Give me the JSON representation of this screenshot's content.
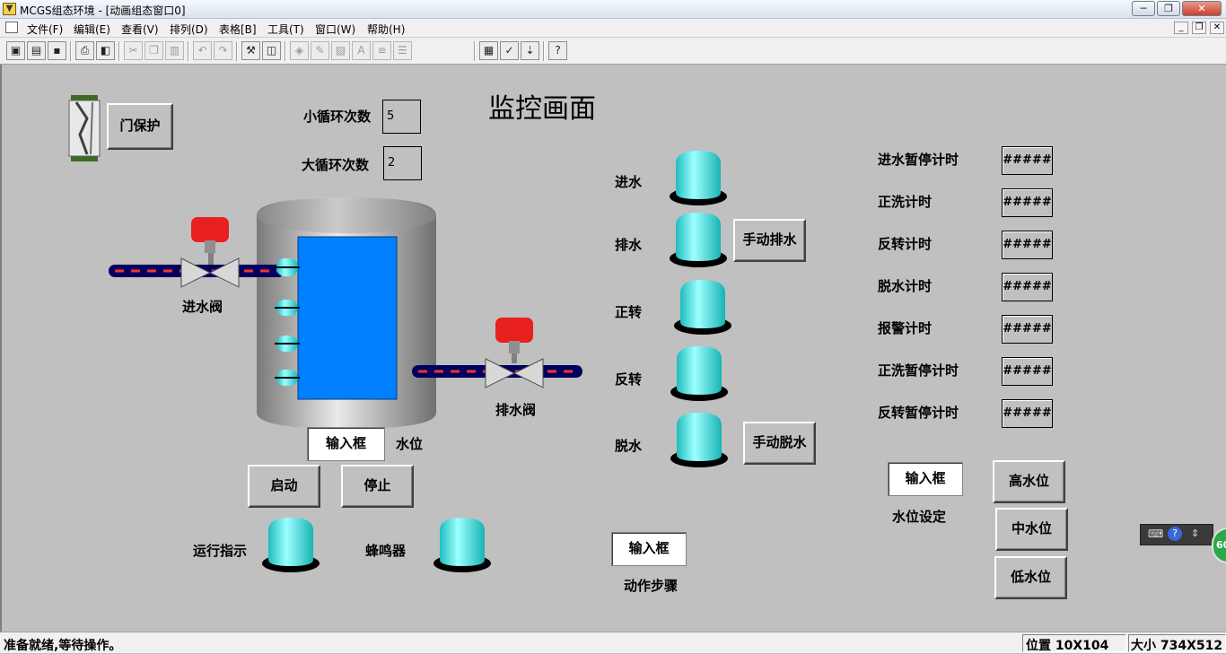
{
  "window": {
    "title": "MCGS组态环境 - [动画组态窗口0]",
    "icon": "mcgs-app-icon",
    "controls": {
      "minimize": "─",
      "restore": "❐",
      "close": "✕"
    }
  },
  "menubar": {
    "items": [
      "文件(F)",
      "编辑(E)",
      "查看(V)",
      "排列(D)",
      "表格[B]",
      "工具(T)",
      "窗口(W)",
      "帮助(H)"
    ],
    "mdi_controls": {
      "minimize": "_",
      "restore": "❐",
      "close": "✕"
    }
  },
  "toolbar": {
    "icons": [
      "window-icon",
      "open-icon",
      "save-icon",
      "print-icon",
      "preview-icon",
      "cut-icon",
      "copy-icon",
      "paste-icon",
      "undo-icon",
      "redo-icon",
      "tools-icon",
      "layout-icon",
      "fill-icon",
      "edit-icon",
      "image-icon",
      "font-icon",
      "align-icon",
      "list-icon",
      "properties-icon",
      "check-icon",
      "download-icon",
      "help-icon"
    ]
  },
  "canvas": {
    "title": "监控画面",
    "door": {
      "button": "门保护"
    },
    "small_loop": {
      "label": "小循环次数",
      "value": "5"
    },
    "big_loop": {
      "label": "大循环次数",
      "value": "2"
    },
    "inlet_valve_label": "进水阀",
    "drain_valve_label": "排水阀",
    "water_level": {
      "input": "输入框",
      "label": "水位"
    },
    "start_button": "启动",
    "stop_button": "停止",
    "run_indicator_label": "运行指示",
    "buzzer_label": "蜂鸣器",
    "status_lamps": [
      {
        "label": "进水"
      },
      {
        "label": "排水",
        "button": "手动排水"
      },
      {
        "label": "正转"
      },
      {
        "label": "反转"
      },
      {
        "label": "脱水",
        "button": "手动脱水"
      }
    ],
    "action_step": {
      "input": "输入框",
      "label": "动作步骤"
    },
    "timers": [
      {
        "label": "进水暂停计时",
        "value": "#####"
      },
      {
        "label": "正洗计时",
        "value": "#####"
      },
      {
        "label": "反转计时",
        "value": "#####"
      },
      {
        "label": "脱水计时",
        "value": "#####"
      },
      {
        "label": "报警计时",
        "value": "#####"
      },
      {
        "label": "正洗暂停计时",
        "value": "#####"
      },
      {
        "label": "反转暂停计时",
        "value": "#####"
      }
    ],
    "level_setting": {
      "input": "输入框",
      "label": "水位设定"
    },
    "level_buttons": [
      "高水位",
      "中水位",
      "低水位"
    ],
    "colors": {
      "lamp": "#33ffff",
      "water": "#0080ff",
      "valve_head": "#ee2222",
      "pipe": "#000080",
      "pipe_dash": "#ff3030"
    }
  },
  "floating_widget": {
    "badge": "60"
  },
  "statusbar": {
    "message": "准备就绪,等待操作。",
    "position": "位置 10X104",
    "size": "大小 734X512"
  }
}
